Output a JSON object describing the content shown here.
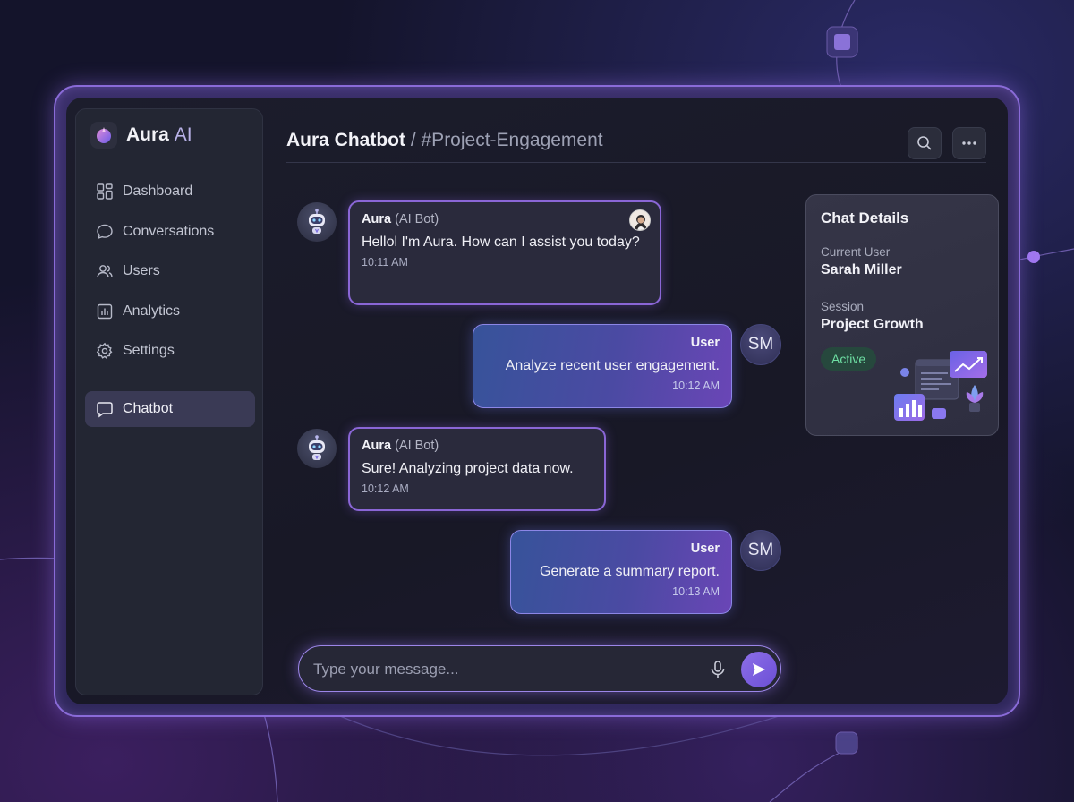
{
  "brand": {
    "name": "Aura",
    "accent": "AI"
  },
  "nav": {
    "items": [
      {
        "label": "Dashboard",
        "icon": "grid-icon"
      },
      {
        "label": "Conversations",
        "icon": "chat-bubble-icon"
      },
      {
        "label": "Users",
        "icon": "users-icon"
      },
      {
        "label": "Analytics",
        "icon": "bar-chart-icon"
      },
      {
        "label": "Settings",
        "icon": "gear-icon"
      }
    ],
    "active": {
      "label": "Chatbot",
      "icon": "chat-bubble-icon"
    }
  },
  "header": {
    "title": "Aura Chatbot",
    "channel": " / #Project-Engagement"
  },
  "messages": [
    {
      "sender": "Aura",
      "role": "(AI Bot)",
      "text": "Hellol I'm Aura. How can I assist you today?",
      "time": "10:11 AM"
    },
    {
      "sender": "User",
      "initials": "SM",
      "text": "Analyze recent user engagement.",
      "time": "10:12 AM"
    },
    {
      "sender": "Aura",
      "role": "(AI Bot)",
      "text": "Sure! Analyzing project data now.",
      "time": "10:12 AM"
    },
    {
      "sender": "User",
      "initials": "SM",
      "text": "Generate a summary report.",
      "time": "10:13 AM"
    }
  ],
  "details": {
    "title": "Chat Details",
    "current_user_label": "Current User",
    "current_user": "Sarah Miller",
    "session_label": "Session",
    "session": "Project Growth",
    "status": "Active"
  },
  "composer": {
    "placeholder": "Type your message..."
  },
  "colors": {
    "accent": "#8a66d6",
    "status_active": "#6ee0a4",
    "user_bubble": "#4b4aa3"
  }
}
